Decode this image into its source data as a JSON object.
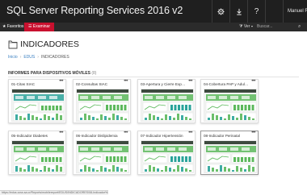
{
  "header": {
    "app_title": "SQL Server Reporting Services 2016 v2",
    "settings_icon": "gear-icon",
    "download_icon": "download-icon",
    "help_label": "?",
    "user_name": "Manuel Rodriguez Arce"
  },
  "toolbar": {
    "favorites_label": "★ Favoritos",
    "explore_label": "☰ Examinar",
    "view_label": "⧩ Ver ▾",
    "search_placeholder": "Buscar..."
  },
  "page": {
    "title": "INDICADORES",
    "breadcrumb": [
      "Inicio",
      "EDUS",
      "INDICADORES"
    ],
    "section_title": "INFORMES PARA DISPOSITIVOS MÓVILES",
    "section_count": "(8)"
  },
  "reports": [
    {
      "title": "01-Citas SIAC"
    },
    {
      "title": "02-Consultas SIAC"
    },
    {
      "title": "03-Apertura y Cierre Expedie..."
    },
    {
      "title": "04-Cobertura PAP y Adulto..."
    },
    {
      "title": "05-Indicador Diabetes"
    },
    {
      "title": "06-Indicador Dislipidemia"
    },
    {
      "title": "07-Indicador Hipertensión"
    },
    {
      "title": "08-Indicador Perinatal"
    }
  ],
  "card_menu_label": "•••",
  "status_url": "https://edus.ccss.sa.cr/Reports/mobilereport/EDUS/INDICADORES/08-Indicador%20Perinatal",
  "colors": {
    "topbar": "#1f1f1f",
    "accent_red": "#c8102e",
    "link_blue": "#3a7fc1",
    "thumb_green": "#5cb85c",
    "thumb_teal": "#2aa39a"
  }
}
